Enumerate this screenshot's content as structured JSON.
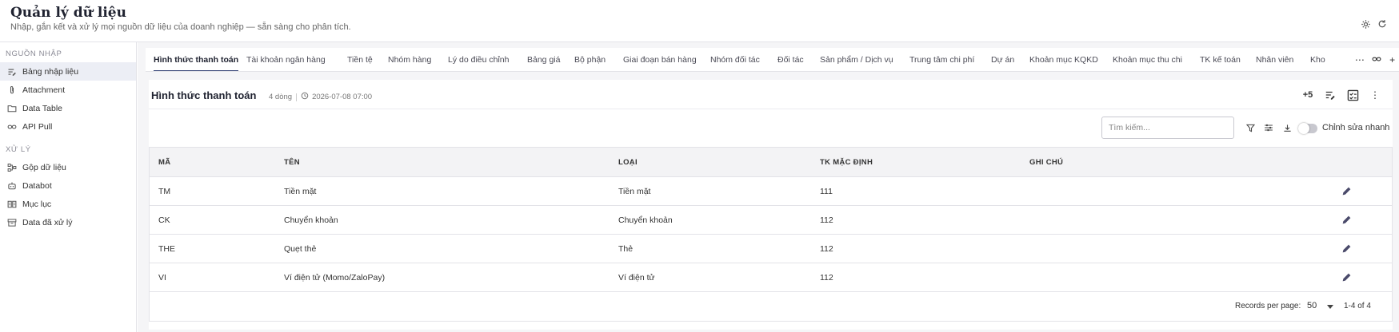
{
  "app": {
    "title": "Quản lý dữ liệu",
    "subtitle": "Nhập, gắn kết và xử lý mọi nguồn dữ liệu của doanh nghiệp — sẵn sàng cho phân tích."
  },
  "sidebar": {
    "sections": [
      {
        "title": "NGUỒN NHẬP",
        "items": [
          {
            "label": "Bảng nhập liệu",
            "icon": "edit-list-icon",
            "active": true
          },
          {
            "label": "Attachment",
            "icon": "paperclip-icon",
            "active": false
          },
          {
            "label": "Data Table",
            "icon": "folder-icon",
            "active": false
          },
          {
            "label": "API Pull",
            "icon": "link-icon",
            "active": false
          }
        ]
      },
      {
        "title": "XỬ LÝ",
        "items": [
          {
            "label": "Gộp dữ liệu",
            "icon": "merge-icon",
            "active": false
          },
          {
            "label": "Databot",
            "icon": "robot-icon",
            "active": false
          },
          {
            "label": "Mục lục",
            "icon": "book-icon",
            "active": false
          },
          {
            "label": "Data đã xử lý",
            "icon": "archive-icon",
            "active": false
          }
        ]
      }
    ]
  },
  "tabs": [
    "Hình thức thanh toán",
    "Tài khoản ngân hàng",
    "Tiền tệ",
    "Nhóm hàng",
    "Lý do điều chỉnh",
    "Bảng giá",
    "Bộ phận",
    "Giai đoạn bán hàng",
    "Nhóm đối tác",
    "Đối tác",
    "Sản phẩm / Dịch vụ",
    "Trung tâm chi phí",
    "Dự án",
    "Khoản mục KQKD",
    "Khoản mục thu chi",
    "TK kế toán",
    "Nhân viên",
    "Kho"
  ],
  "active_tab": 0,
  "card": {
    "title": "Hình thức thanh toán",
    "row_count": "4 dòng",
    "timestamp": "2026-07-08 07:00",
    "extra_count": "+5"
  },
  "toolbar": {
    "search_placeholder": "Tìm kiếm...",
    "quick_edit_label": "Chỉnh sửa nhanh",
    "quick_edit_on": false
  },
  "table": {
    "columns": [
      "MÃ",
      "TÊN",
      "LOẠI",
      "TK MẶC ĐỊNH",
      "GHI CHÚ"
    ],
    "rows": [
      [
        "TM",
        "Tiền mặt",
        "Tiền mặt",
        "111",
        ""
      ],
      [
        "CK",
        "Chuyển khoản",
        "Chuyển khoản",
        "112",
        ""
      ],
      [
        "THE",
        "Quẹt thẻ",
        "Thẻ",
        "112",
        ""
      ],
      [
        "VI",
        "Ví điện tử (Momo/ZaloPay)",
        "Ví điện tử",
        "112",
        ""
      ]
    ]
  },
  "pagination": {
    "records_per_page_label": "Records per page:",
    "records_per_page": "50",
    "range": "1-4 of 4"
  },
  "colors": {
    "accent": "#3b4a7a",
    "active_sidebar_bg": "#eceef5"
  }
}
